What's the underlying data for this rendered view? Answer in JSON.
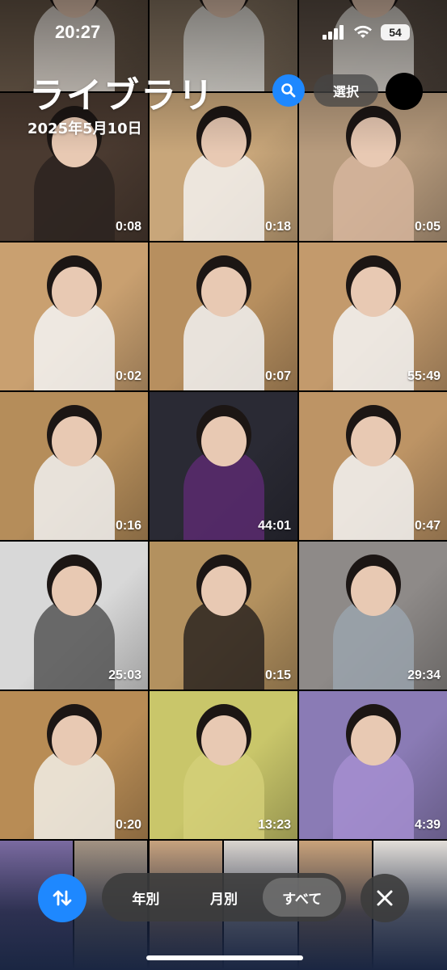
{
  "status": {
    "time": "20:27",
    "battery": "54"
  },
  "header": {
    "title": "ライブラリ",
    "date": "2025年5月10日",
    "select_label": "選択"
  },
  "grid": {
    "rows": [
      [
        {
          "duration": ""
        },
        {
          "duration": ""
        },
        {
          "duration": ""
        }
      ],
      [
        {
          "duration": "0:08"
        },
        {
          "duration": "0:18"
        },
        {
          "duration": "0:05"
        }
      ],
      [
        {
          "duration": "0:02"
        },
        {
          "duration": "0:07"
        },
        {
          "duration": "55:49"
        }
      ],
      [
        {
          "duration": "0:16"
        },
        {
          "duration": "44:01"
        },
        {
          "duration": "0:47"
        }
      ],
      [
        {
          "duration": "25:03"
        },
        {
          "duration": "0:15"
        },
        {
          "duration": "29:34"
        }
      ],
      [
        {
          "duration": "0:20"
        },
        {
          "duration": "13:23"
        },
        {
          "duration": "4:39"
        }
      ]
    ]
  },
  "bottom_bar": {
    "segments": [
      "年別",
      "月別",
      "すべて"
    ],
    "active_segment": "すべて"
  },
  "colors": {
    "accent": "#1e88ff"
  }
}
